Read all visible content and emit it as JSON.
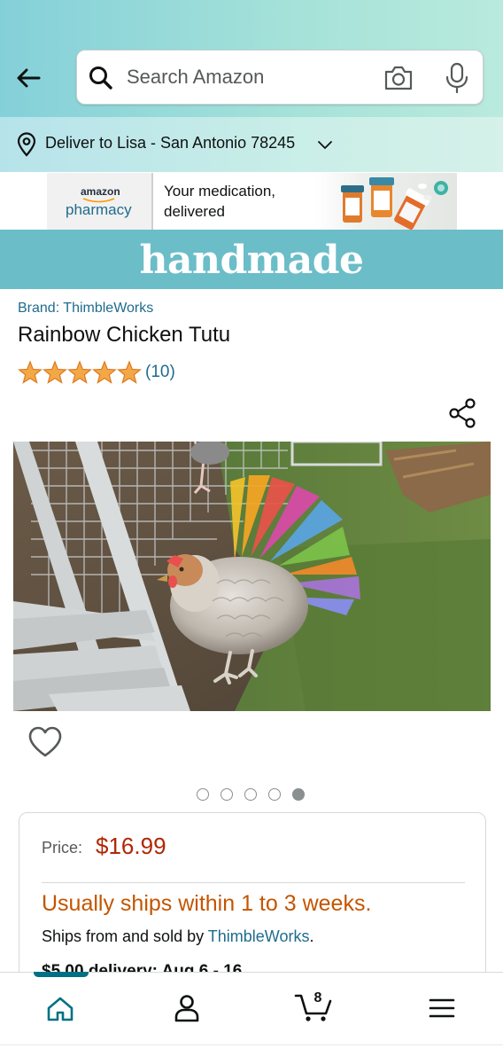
{
  "header": {
    "search_placeholder": "Search Amazon",
    "back_icon": "arrow-left-icon",
    "search_icon": "magnifier-icon",
    "camera_icon": "camera-icon",
    "mic_icon": "microphone-icon"
  },
  "delivery_bar": {
    "text": "Deliver to Lisa - San Antonio 78245",
    "icon": "location-pin-icon"
  },
  "ad_banner": {
    "brand_top": "amazon",
    "brand_bottom": "pharmacy",
    "line1": "Your medication,",
    "line2": "delivered"
  },
  "store_banner": {
    "text": "handmade",
    "color": "#6bbdc8"
  },
  "product": {
    "brand": "Brand: ThimbleWorks",
    "title": "Rainbow Chicken Tutu",
    "rating": 5,
    "rating_count": "(10)",
    "image_count": 5,
    "active_image_index": 4
  },
  "buybox": {
    "price_label": "Price:",
    "price": "$16.99",
    "ships": "Usually ships within 1 to 3 weeks.",
    "sold_prefix": "Ships from and sold by ",
    "seller": "ThimbleWorks",
    "sold_suffix": ".",
    "delivery": "$5.00 delivery: Aug 6 - 16"
  },
  "bottom_nav": {
    "cart_count": "8",
    "items": [
      "home-icon",
      "account-icon",
      "cart-icon",
      "menu-icon"
    ]
  },
  "colors": {
    "link": "#1f6c8d",
    "price": "#b12704",
    "ships": "#c45500",
    "star": "#f3a847"
  }
}
